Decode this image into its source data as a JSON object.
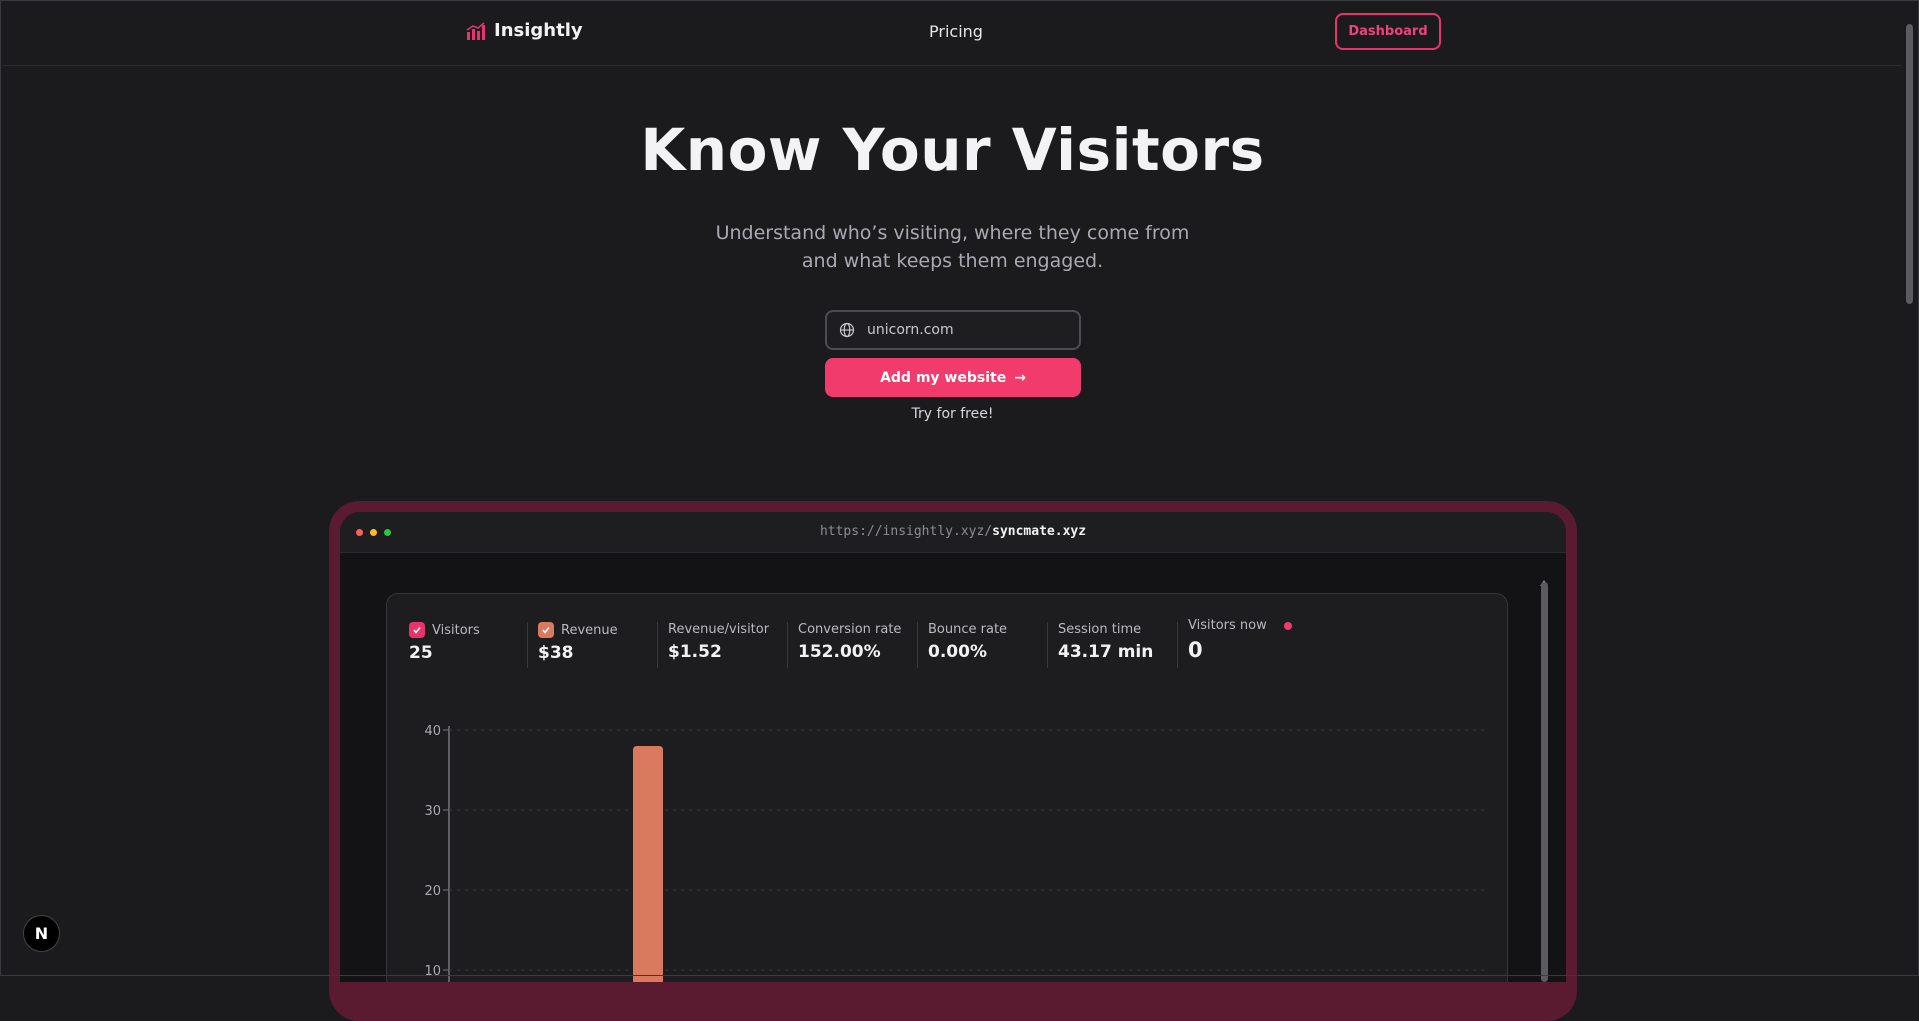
{
  "nav": {
    "brand": "Insightly",
    "pricing": "Pricing",
    "dashboard": "Dashboard"
  },
  "hero": {
    "title": "Know Your Visitors",
    "subtitle_line1": "Understand who’s visiting, where they come from",
    "subtitle_line2": "and what keeps them engaged.",
    "input_placeholder": "unicorn.com",
    "cta": "Add my website",
    "note": "Try for free!"
  },
  "browser": {
    "url_prefix": "https://insightly.xyz/",
    "url_site": "syncmate.xyz"
  },
  "stats": {
    "visitors": {
      "label": "Visitors",
      "value": "25"
    },
    "revenue": {
      "label": "Revenue",
      "value": "$38"
    },
    "revenue_per_visitor": {
      "label": "Revenue/visitor",
      "value": "$1.52"
    },
    "conversion_rate": {
      "label": "Conversion rate",
      "value": "152.00%"
    },
    "bounce_rate": {
      "label": "Bounce rate",
      "value": "0.00%"
    },
    "session_time": {
      "label": "Session time",
      "value": "43.17 min"
    },
    "visitors_now": {
      "label": "Visitors now",
      "value": "0"
    }
  },
  "colors": {
    "accent": "#f23b6d",
    "revenue": "#d97a5f",
    "bg": "#1b1b1e"
  },
  "chart_data": {
    "type": "bar",
    "y_ticks": [
      "40",
      "30",
      "20",
      "10"
    ],
    "ylim": [
      0,
      40
    ],
    "bar_value": 38,
    "grid": true
  }
}
